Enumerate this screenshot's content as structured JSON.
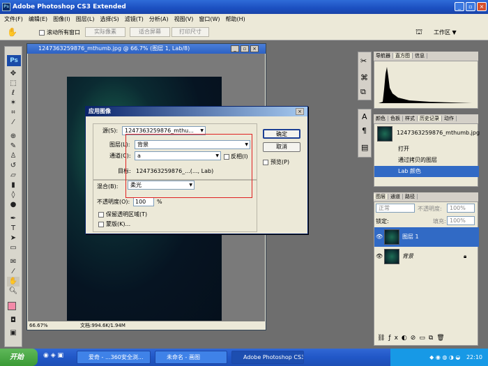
{
  "app": {
    "title": "Adobe Photoshop CS3 Extended",
    "logo": "Ps"
  },
  "menu": [
    "文件(F)",
    "编辑(E)",
    "图像(I)",
    "图层(L)",
    "选择(S)",
    "滤镜(T)",
    "分析(A)",
    "视图(V)",
    "窗口(W)",
    "帮助(H)"
  ],
  "options": {
    "scroll_all": "滚动所有窗口",
    "actual_pixels": "实际像素",
    "fit_screen": "适合屏幕",
    "print_size": "打印尺寸",
    "workspace": "工作区 ▼"
  },
  "document": {
    "title": "1247363259876_mthumb.jpg @ 66.7% (图层 1, Lab/8)",
    "zoom": "66.67%",
    "doc_info": "文档:994.6K/1.94M"
  },
  "dialog": {
    "title": "应用图像",
    "source_label": "源(S):",
    "source_value": "1247363259876_mthu...",
    "layer_label": "图层(L):",
    "layer_value": "背景",
    "channel_label": "通道(C):",
    "channel_value": "a",
    "invert_label": "反相(I)",
    "target_label": "目标:",
    "target_value": "1247363259876_...(..., Lab)",
    "blend_label": "混合(B):",
    "blend_value": "柔光",
    "opacity_label": "不透明度(O):",
    "opacity_value": "100",
    "opacity_unit": "%",
    "preserve_label": "保留透明区域(T)",
    "mask_label": "蒙版(K)...",
    "ok": "确定",
    "cancel": "取消",
    "preview_label": "预览(P)"
  },
  "panels": {
    "top_tabs": [
      "导航器",
      "直方图",
      "信息"
    ],
    "history_tabs": [
      "颜色",
      "色板",
      "样式",
      "历史记录",
      "动作"
    ],
    "history_snapshot": "1247363259876_mthumb.jpg",
    "history_items": [
      "打开",
      "通过拷贝的图层",
      "Lab 颜色"
    ],
    "layers_tabs": [
      "图层",
      "通道",
      "路径"
    ],
    "blend_mode": "正常",
    "opacity_label": "不透明度:",
    "opacity_value": "100%",
    "lock_label": "锁定:",
    "fill_label": "填充:",
    "fill_value": "100%",
    "layers": [
      "图层 1",
      "背景"
    ]
  },
  "taskbar": {
    "start": "开始",
    "items": [
      "爱奇 - ...360安全浏...",
      "未命名 - 画图",
      "Adobe Photoshop CS3..."
    ],
    "clock": "22:10"
  },
  "colors": {
    "foreground": "#f38aa8",
    "background": "#ffffff",
    "selection": "#316ac5"
  }
}
